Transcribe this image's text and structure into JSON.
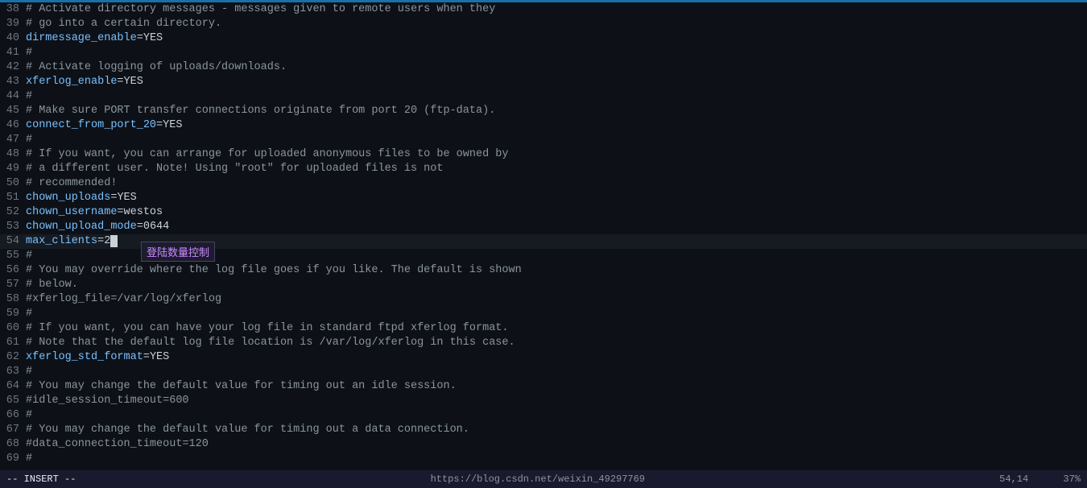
{
  "editor": {
    "progress_bar_color": "#1a6fa8",
    "lines": [
      {
        "num": 38,
        "content": "# Activate directory messages - messages given to remote users when they",
        "type": "comment"
      },
      {
        "num": 39,
        "content": "# go into a certain directory.",
        "type": "comment"
      },
      {
        "num": 40,
        "content": "dirmessage_enable=YES",
        "type": "config"
      },
      {
        "num": 41,
        "content": "#",
        "type": "comment"
      },
      {
        "num": 42,
        "content": "# Activate logging of uploads/downloads.",
        "type": "comment"
      },
      {
        "num": 43,
        "content": "xferlog_enable=YES",
        "type": "config"
      },
      {
        "num": 44,
        "content": "#",
        "type": "comment"
      },
      {
        "num": 45,
        "content": "# Make sure PORT transfer connections originate from port 20 (ftp-data).",
        "type": "comment"
      },
      {
        "num": 46,
        "content": "connect_from_port_20=YES",
        "type": "config"
      },
      {
        "num": 47,
        "content": "#",
        "type": "comment"
      },
      {
        "num": 48,
        "content": "# If you want, you can arrange for uploaded anonymous files to be owned by",
        "type": "comment"
      },
      {
        "num": 49,
        "content": "# a different user. Note! Using \"root\" for uploaded files is not",
        "type": "comment"
      },
      {
        "num": 50,
        "content": "# recommended!",
        "type": "comment"
      },
      {
        "num": 51,
        "content": "chown_uploads=YES",
        "type": "config"
      },
      {
        "num": 52,
        "content": "chown_username=westos",
        "type": "config"
      },
      {
        "num": 53,
        "content": "chown_upload_mode=0644",
        "type": "config"
      },
      {
        "num": 54,
        "content": "max_clients=2",
        "type": "config-cursor"
      },
      {
        "num": 55,
        "content": "#",
        "type": "comment"
      },
      {
        "num": 56,
        "content": "# You may override where the log file goes if you like. The default is shown",
        "type": "comment"
      },
      {
        "num": 57,
        "content": "# below.",
        "type": "comment"
      },
      {
        "num": 58,
        "content": "#xferlog_file=/var/log/xferlog",
        "type": "comment"
      },
      {
        "num": 59,
        "content": "#",
        "type": "comment"
      },
      {
        "num": 60,
        "content": "# If you want, you can have your log file in standard ftpd xferlog format.",
        "type": "comment"
      },
      {
        "num": 61,
        "content": "# Note that the default log file location is /var/log/xferlog in this case.",
        "type": "comment"
      },
      {
        "num": 62,
        "content": "xferlog_std_format=YES",
        "type": "config"
      },
      {
        "num": 63,
        "content": "#",
        "type": "comment"
      },
      {
        "num": 64,
        "content": "# You may change the default value for timing out an idle session.",
        "type": "comment"
      },
      {
        "num": 65,
        "content": "#idle_session_timeout=600",
        "type": "comment"
      },
      {
        "num": 66,
        "content": "#",
        "type": "comment"
      },
      {
        "num": 67,
        "content": "# You may change the default value for timing out a data connection.",
        "type": "comment"
      },
      {
        "num": 68,
        "content": "#data_connection_timeout=120",
        "type": "comment"
      },
      {
        "num": 69,
        "content": "#",
        "type": "comment"
      }
    ],
    "tooltip": {
      "text": "登陆数量控制",
      "visible": true
    }
  },
  "statusbar": {
    "mode": "-- INSERT --",
    "position": "54,14",
    "scroll": "37%",
    "url": "https://blog.csdn.net/weixin_49297769"
  }
}
